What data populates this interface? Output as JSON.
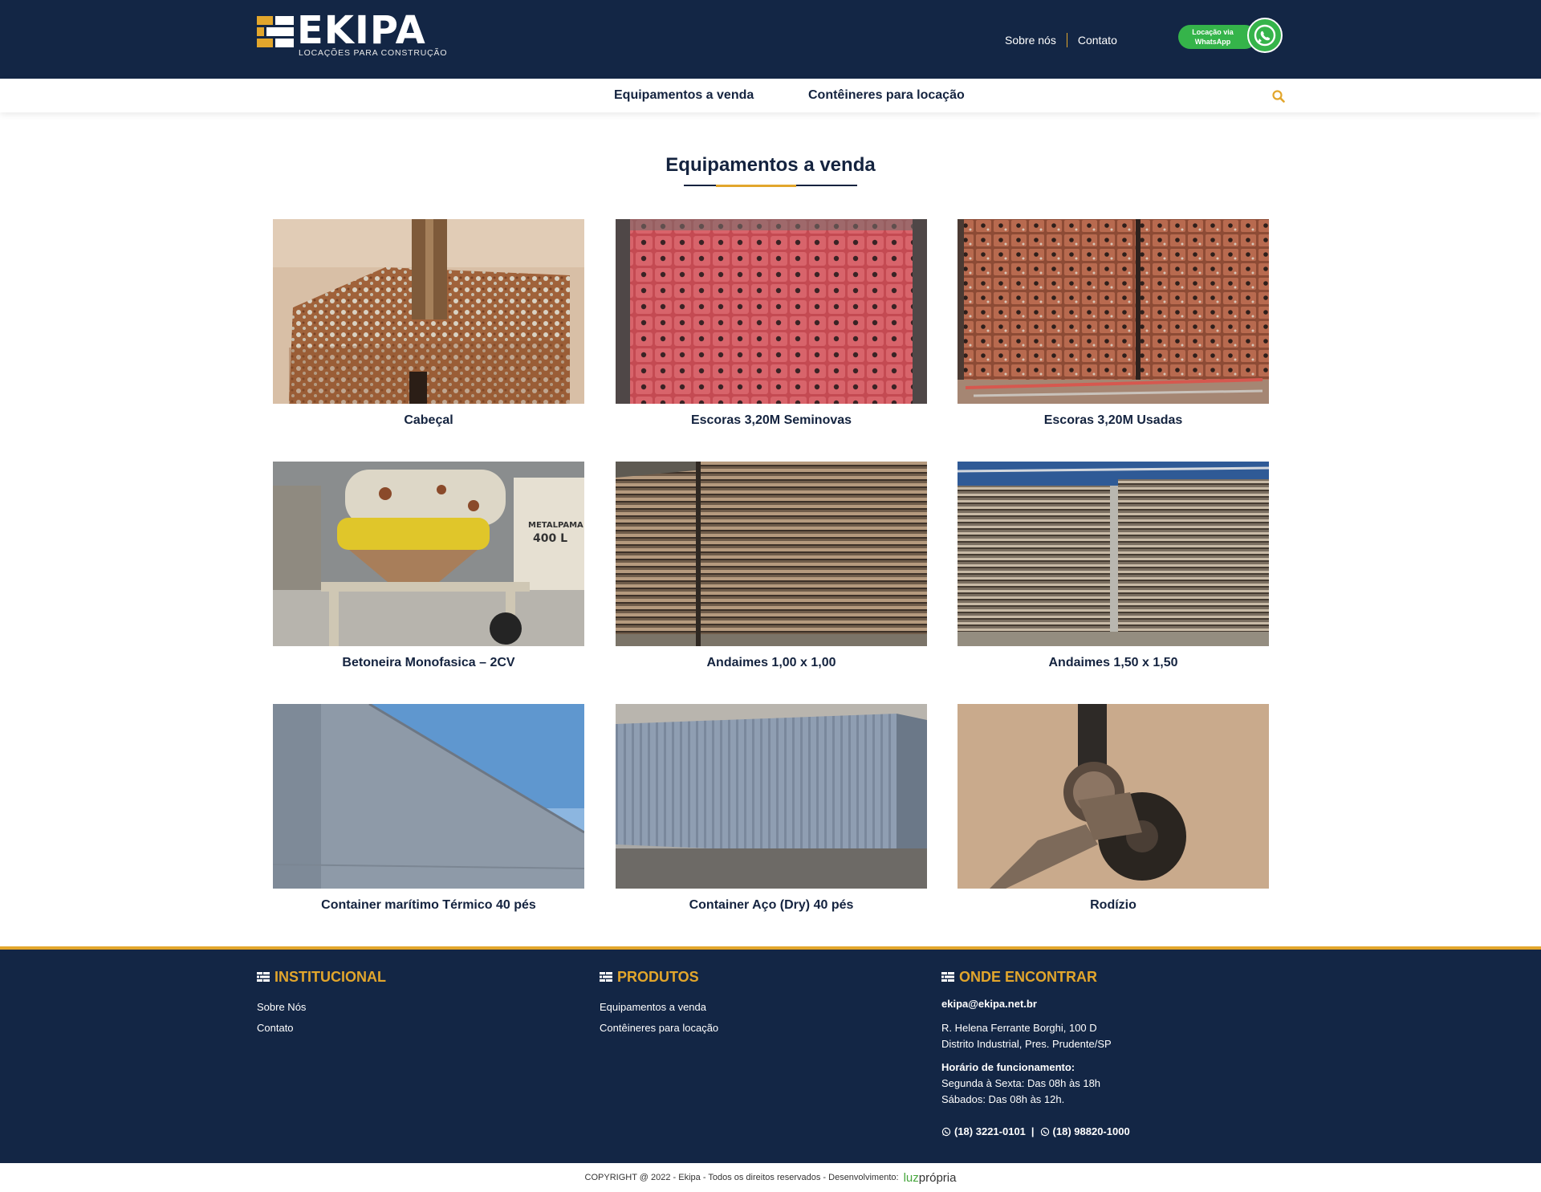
{
  "header": {
    "logo_text": "EKIPA",
    "logo_subtitle": "LOCAÇÕES PARA CONSTRUÇÃO",
    "links": [
      "Sobre nós",
      "Contato"
    ],
    "whatsapp_line1": "Locação via",
    "whatsapp_line2": "WhatsApp"
  },
  "nav": {
    "items": [
      "Equipamentos a venda",
      "Contêineres para locação"
    ],
    "search_icon": "search-icon"
  },
  "main": {
    "title": "Equipamentos a venda",
    "products": [
      {
        "name": "Cabeçal"
      },
      {
        "name": "Escoras 3,20M Seminovas"
      },
      {
        "name": "Escoras 3,20M Usadas"
      },
      {
        "name": "Betoneira Monofasica – 2CV"
      },
      {
        "name": "Andaimes 1,00 x 1,00"
      },
      {
        "name": "Andaimes 1,50 x 1,50"
      },
      {
        "name": "Container marítimo Térmico 40 pés"
      },
      {
        "name": "Container Aço (Dry) 40 pés"
      },
      {
        "name": "Rodízio"
      }
    ]
  },
  "footer": {
    "institucional": {
      "title": "INSTITUCIONAL",
      "links": [
        "Sobre Nós",
        "Contato"
      ]
    },
    "produtos": {
      "title": "PRODUTOS",
      "links": [
        "Equipamentos a venda",
        "Contêineres para locação"
      ]
    },
    "onde": {
      "title": "ONDE ENCONTRAR",
      "email": "ekipa@ekipa.net.br",
      "address_line1": "R. Helena Ferrante Borghi, 100 D",
      "address_line2": "Distrito Industrial, Pres. Prudente/SP",
      "hours_title": "Horário de funcionamento:",
      "hours_line1": "Segunda à Sexta: Das 08h às 18h",
      "hours_line2": "Sábados: Das 08h às 12h.",
      "phone1": "(18) 3221-0101",
      "phone_sep": "|",
      "phone2": "(18) 98820-1000"
    }
  },
  "copyright": {
    "text": "COPYRIGHT @ 2022 - Ekipa - Todos os direitos reservados - Desenvolvimento:",
    "brand_part1": "luz",
    "brand_part2": "própria"
  },
  "colors": {
    "navy": "#132645",
    "gold": "#e2a62c",
    "whatsapp_green": "#35b44a"
  }
}
